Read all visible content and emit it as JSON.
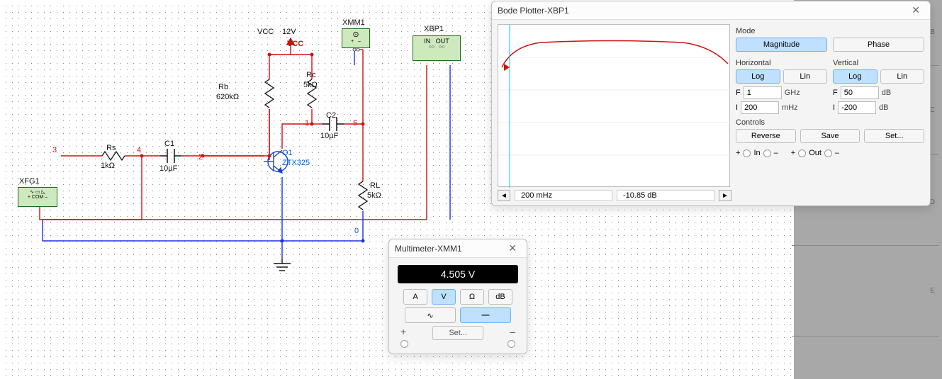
{
  "circuit": {
    "vcc": {
      "name": "VCC",
      "value": "12V",
      "net": "VCC"
    },
    "xfg1": "XFG1",
    "xmm1": "XMM1",
    "xbp1": {
      "name": "XBP1",
      "in": "IN",
      "out": "OUT"
    },
    "rs": {
      "name": "Rs",
      "value": "1kΩ"
    },
    "c1": {
      "name": "C1",
      "value": "10µF"
    },
    "rb": {
      "name": "Rb",
      "value": "620kΩ"
    },
    "rc": {
      "name": "Rc",
      "value": "5kΩ"
    },
    "c2": {
      "name": "C2",
      "value": "10µF"
    },
    "rl": {
      "name": "RL",
      "value": "5kΩ"
    },
    "q1": {
      "name": "Q1",
      "model": "ZTX325"
    },
    "nodes": {
      "n0": "0",
      "n1": "1",
      "n2": "2",
      "n3": "3",
      "n4": "4",
      "n5": "5"
    }
  },
  "bode": {
    "title": "Bode Plotter-XBP1",
    "mode_label": "Mode",
    "magnitude_btn": "Magnitude",
    "phase_btn": "Phase",
    "horizontal_label": "Horizontal",
    "vertical_label": "Vertical",
    "log_btn": "Log",
    "lin_btn": "Lin",
    "F": "F",
    "I": "I",
    "h_F_val": "1",
    "h_F_unit": "GHz",
    "h_I_val": "200",
    "h_I_unit": "mHz",
    "v_F_val": "50",
    "v_F_unit": "dB",
    "v_I_val": "-200",
    "v_I_unit": "dB",
    "controls_label": "Controls",
    "reverse_btn": "Reverse",
    "save_btn": "Save",
    "set_btn": "Set...",
    "in_label": "In",
    "out_label": "Out",
    "plus": "+",
    "minus": "–",
    "cursor_x": "200 mHz",
    "cursor_y": "-10.85 dB"
  },
  "mm": {
    "title": "Multimeter-XMM1",
    "display": "4.505 V",
    "A": "A",
    "V": "V",
    "Ohm": "Ω",
    "dB": "dB",
    "ac": "∿",
    "dc": "—",
    "set_btn": "Set...",
    "plus": "+",
    "minus": "–"
  },
  "ruler": {
    "B": "B",
    "C": "C",
    "D": "D",
    "E": "E"
  }
}
